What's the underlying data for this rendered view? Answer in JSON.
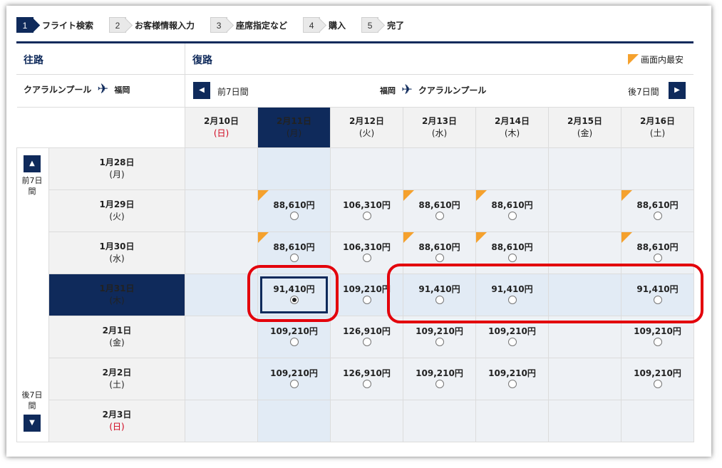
{
  "steps": [
    {
      "num": "1",
      "label": "フライト検索"
    },
    {
      "num": "2",
      "label": "お客様情報入力"
    },
    {
      "num": "3",
      "label": "座席指定など"
    },
    {
      "num": "4",
      "label": "購入"
    },
    {
      "num": "5",
      "label": "完了"
    }
  ],
  "outbound": {
    "title": "往路",
    "from": "クアラルンプール",
    "to": "福岡"
  },
  "return": {
    "title": "復路",
    "from": "福岡",
    "to": "クアラルンプール",
    "prev_label": "前7日間",
    "next_label": "後7日間"
  },
  "legend": {
    "label": "画面内最安"
  },
  "side": {
    "prev_label_1": "前7日",
    "prev_label_2": "間",
    "next_label_1": "後7日",
    "next_label_2": "間"
  },
  "columns": [
    {
      "date": "2月10日",
      "weekday": "(日)",
      "holiday": true
    },
    {
      "date": "2月11日",
      "weekday": "(月)",
      "selected": true
    },
    {
      "date": "2月12日",
      "weekday": "(火)"
    },
    {
      "date": "2月13日",
      "weekday": "(水)"
    },
    {
      "date": "2月14日",
      "weekday": "(木)"
    },
    {
      "date": "2月15日",
      "weekday": "(金)"
    },
    {
      "date": "2月16日",
      "weekday": "(土)"
    }
  ],
  "rows": [
    {
      "date": "1月28日",
      "weekday": "(月)",
      "prices": [
        "",
        "",
        "",
        "",
        "",
        "",
        ""
      ]
    },
    {
      "date": "1月29日",
      "weekday": "(火)",
      "prices": [
        "",
        "88,610円",
        "106,310円",
        "88,610円",
        "88,610円",
        "",
        "88,610円"
      ],
      "cheapest": [
        1,
        3,
        4,
        6
      ]
    },
    {
      "date": "1月30日",
      "weekday": "(水)",
      "prices": [
        "",
        "88,610円",
        "106,310円",
        "88,610円",
        "88,610円",
        "",
        "88,610円"
      ],
      "cheapest": [
        1,
        3,
        4,
        6
      ]
    },
    {
      "date": "1月31日",
      "weekday": "(木)",
      "selected": true,
      "prices": [
        "",
        "91,410円",
        "109,210円",
        "91,410円",
        "91,410円",
        "",
        "91,410円"
      ]
    },
    {
      "date": "2月1日",
      "weekday": "(金)",
      "prices": [
        "",
        "109,210円",
        "126,910円",
        "109,210円",
        "109,210円",
        "",
        "109,210円"
      ]
    },
    {
      "date": "2月2日",
      "weekday": "(土)",
      "prices": [
        "",
        "109,210円",
        "126,910円",
        "109,210円",
        "109,210円",
        "",
        "109,210円"
      ]
    },
    {
      "date": "2月3日",
      "weekday": "(日)",
      "holiday": true,
      "prices": [
        "",
        "",
        "",
        "",
        "",
        "",
        ""
      ]
    }
  ],
  "colors": {
    "navy": "#0f2a5b",
    "cheapest_marker": "#f5a12d",
    "highlight": "#e3000b",
    "holiday": "#d0021b"
  }
}
